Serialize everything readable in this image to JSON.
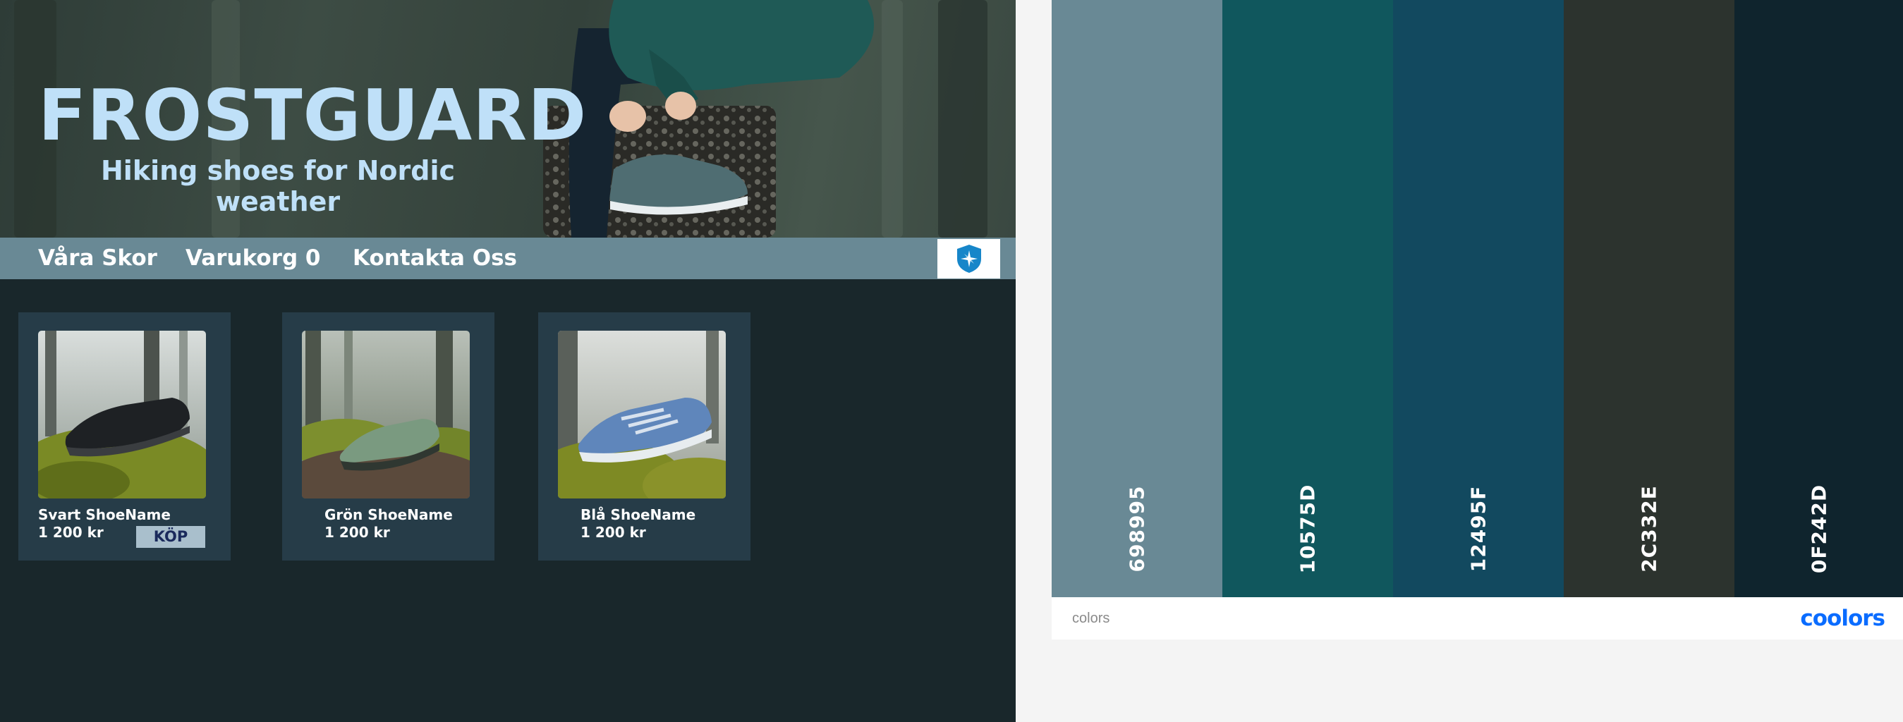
{
  "hero": {
    "title": "FROSTGUARD",
    "subtitle": "Hiking shoes for Nordic weather"
  },
  "nav": {
    "items": [
      "Våra Skor",
      "Varukorg 0",
      "Kontakta Oss"
    ],
    "logo_icon": "compass-shield-icon"
  },
  "products": [
    {
      "name": "Svart ShoeName",
      "price": "1 200 kr",
      "shoe_color": "#1e2124",
      "button": "KÖP"
    },
    {
      "name": "Grön ShoeName",
      "price": "1 200 kr",
      "shoe_color": "#7a9a80"
    },
    {
      "name": "Blå ShoeName",
      "price": "1 200 kr",
      "shoe_color": "#5f86bb"
    }
  ],
  "palette": {
    "colors": [
      {
        "code": "698995",
        "hex": "#698995"
      },
      {
        "code": "10575D",
        "hex": "#10575D"
      },
      {
        "code": "12495F",
        "hex": "#12495F"
      },
      {
        "code": "2C332E",
        "hex": "#2C332E"
      },
      {
        "code": "0F242D",
        "hex": "#0F242D"
      }
    ],
    "footer_label": "colors",
    "brand": "coolors"
  },
  "theme": {
    "accent_text": "#bfe0f8",
    "nav_bg": "#698995",
    "shop_bg": "#19272b",
    "card_bg": "#263c48",
    "button_bg": "#a9bfcc"
  }
}
